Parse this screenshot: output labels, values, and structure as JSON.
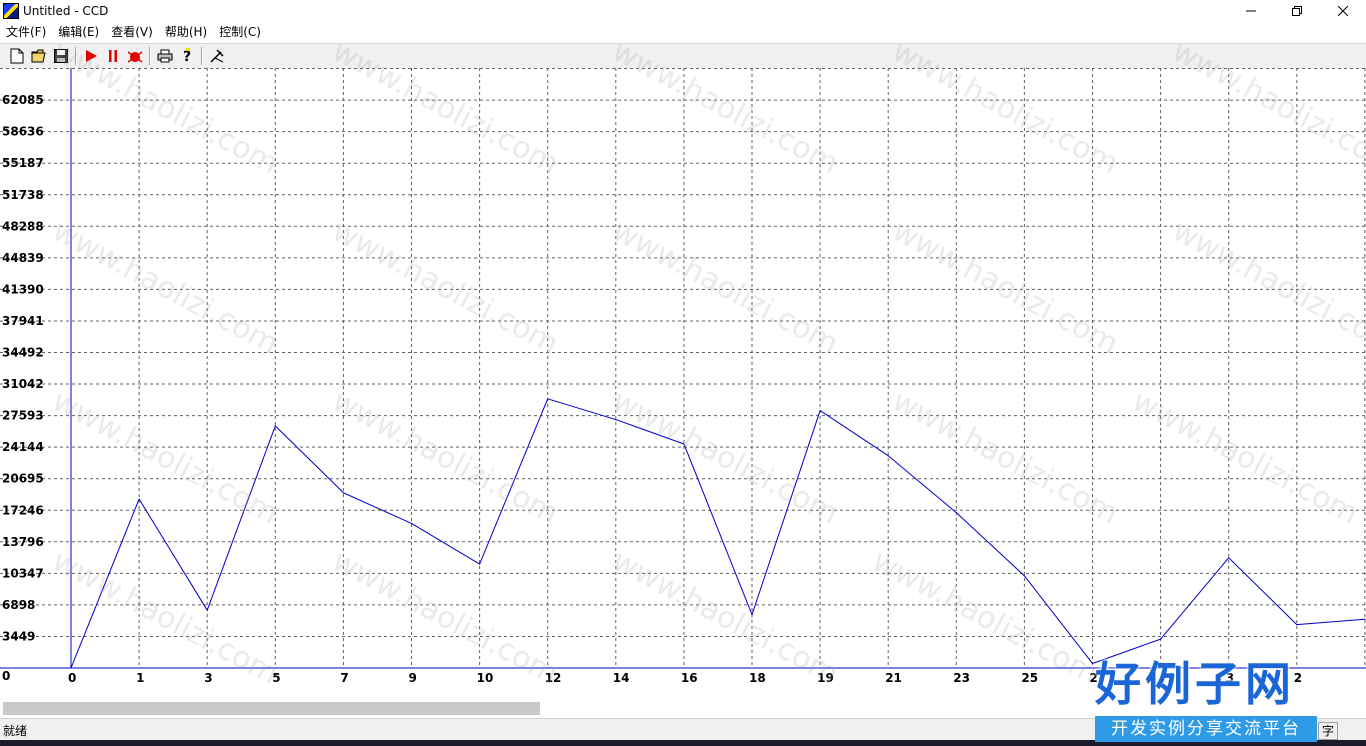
{
  "window": {
    "title": "Untitled - CCD",
    "icon": "ccd-app-icon",
    "controls": [
      "minimize-icon",
      "restore-icon",
      "close-icon"
    ]
  },
  "menu": [
    "文件(F)",
    "编辑(E)",
    "查看(V)",
    "帮助(H)",
    "控制(C)"
  ],
  "toolbar": {
    "groups": [
      [
        "new-file-icon",
        "open-folder-icon",
        "save-icon"
      ],
      [
        "play-icon",
        "pause-icon",
        "stop-bug-icon"
      ],
      [
        "print-icon",
        "help-icon"
      ],
      [
        "tools-icon"
      ]
    ]
  },
  "chart_data": {
    "type": "line",
    "x": [
      0,
      1,
      3,
      5,
      7,
      9,
      10,
      12,
      14,
      16,
      18,
      19,
      21,
      23,
      25,
      27,
      28,
      30,
      32,
      33
    ],
    "y": [
      0,
      18700,
      6400,
      26800,
      19400,
      16000,
      11500,
      29800,
      27500,
      24800,
      5900,
      28500,
      23500,
      17200,
      10200,
      500,
      3200,
      12200,
      4800,
      5400
    ],
    "x_tick_labels": [
      "0",
      "1",
      "3",
      "5",
      "7",
      "9",
      "10",
      "12",
      "14",
      "16",
      "18",
      "19",
      "21",
      "23",
      "25",
      "2",
      "",
      "3",
      "2",
      ""
    ],
    "y_tick_labels": [
      "0",
      "3449",
      "6898",
      "10347",
      "13796",
      "17246",
      "20695",
      "24144",
      "27593",
      "31042",
      "34492",
      "37941",
      "41390",
      "44839",
      "48288",
      "51738",
      "55187",
      "58636",
      "62085"
    ],
    "ylim": [
      0,
      65534
    ],
    "grid": true,
    "line_color": "#0000c8",
    "axis_color": "#0000c8",
    "title": "",
    "xlabel": "",
    "ylabel": ""
  },
  "scrollbar": {
    "position": 0.0
  },
  "status": {
    "text": "就绪",
    "right_pane": "字"
  },
  "watermark": {
    "text": "www.haolizi.com",
    "logo_big": "好例子网",
    "logo_small": "开发实例分享交流平台"
  }
}
